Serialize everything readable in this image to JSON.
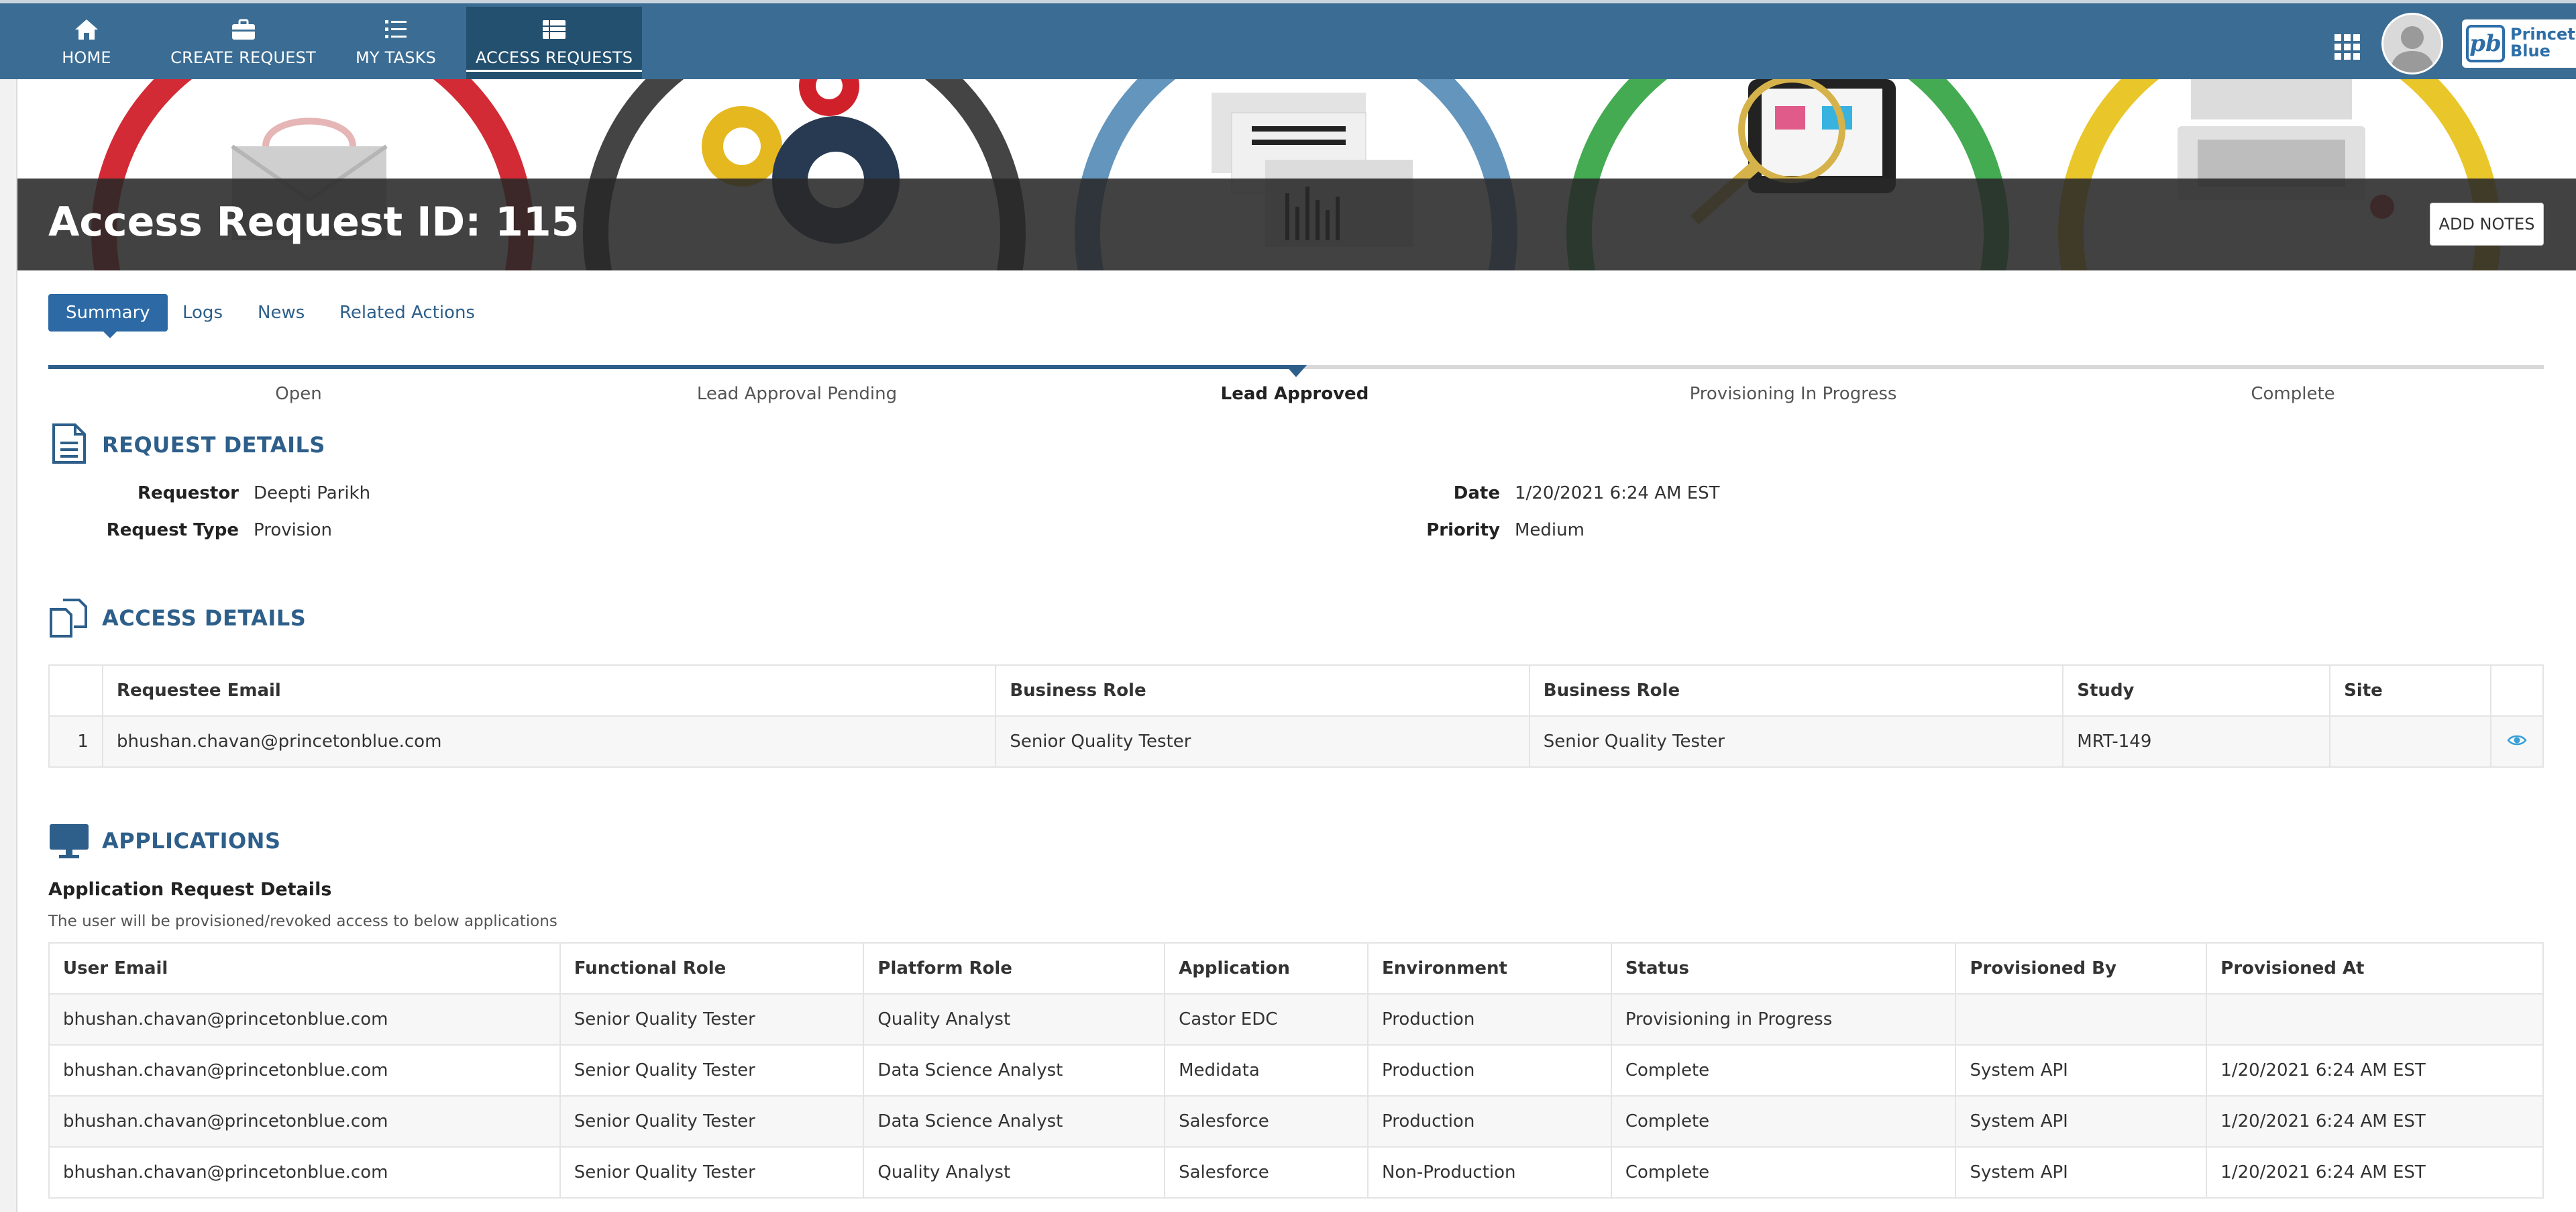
{
  "nav": {
    "items": [
      {
        "label": "HOME",
        "icon": "home-icon"
      },
      {
        "label": "CREATE REQUEST",
        "icon": "briefcase-icon"
      },
      {
        "label": "MY TASKS",
        "icon": "task-list-icon"
      },
      {
        "label": "ACCESS REQUESTS",
        "icon": "list-icon",
        "active": true
      }
    ],
    "brand_text": "Princeton Blue",
    "brand_mark": "pb"
  },
  "page": {
    "title": "Access Request ID: 115",
    "add_notes_label": "ADD NOTES"
  },
  "tabs": [
    {
      "label": "Summary",
      "active": true
    },
    {
      "label": "Logs"
    },
    {
      "label": "News"
    },
    {
      "label": "Related Actions"
    }
  ],
  "stepper": {
    "steps": [
      "Open",
      "Lead Approval Pending",
      "Lead Approved",
      "Provisioning In Progress",
      "Complete"
    ],
    "current_index": 2
  },
  "request_details": {
    "title": "REQUEST DETAILS",
    "requestor_label": "Requestor",
    "requestor": "Deepti Parikh",
    "request_type_label": "Request Type",
    "request_type": "Provision",
    "date_label": "Date",
    "date": "1/20/2021 6:24 AM EST",
    "priority_label": "Priority",
    "priority": "Medium"
  },
  "access_details": {
    "title": "ACCESS DETAILS",
    "columns": [
      "",
      "Requestee Email",
      "Business Role",
      "Business Role",
      "Study",
      "Site",
      ""
    ],
    "rows": [
      [
        "1",
        "bhushan.chavan@princetonblue.com",
        "Senior Quality Tester",
        "Senior Quality Tester",
        "MRT-149",
        ""
      ]
    ]
  },
  "applications": {
    "title": "APPLICATIONS",
    "subtitle": "Application Request Details",
    "description": "The user will be provisioned/revoked access to below applications",
    "columns": [
      "User Email",
      "Functional Role",
      "Platform Role",
      "Application",
      "Environment",
      "Status",
      "Provisioned By",
      "Provisioned At"
    ],
    "rows": [
      [
        "bhushan.chavan@princetonblue.com",
        "Senior Quality Tester",
        "Quality Analyst",
        "Castor EDC",
        "Production",
        "Provisioning in Progress",
        "",
        ""
      ],
      [
        "bhushan.chavan@princetonblue.com",
        "Senior Quality Tester",
        "Data Science Analyst",
        "Medidata",
        "Production",
        "Complete",
        "System API",
        "1/20/2021 6:24 AM EST"
      ],
      [
        "bhushan.chavan@princetonblue.com",
        "Senior Quality Tester",
        "Data Science Analyst",
        "Salesforce",
        "Production",
        "Complete",
        "System API",
        "1/20/2021 6:24 AM EST"
      ],
      [
        "bhushan.chavan@princetonblue.com",
        "Senior Quality Tester",
        "Quality Analyst",
        "Salesforce",
        "Non-Production",
        "Complete",
        "System API",
        "1/20/2021 6:24 AM EST"
      ]
    ]
  },
  "colors": {
    "nav_bg": "#3b6d94",
    "accent": "#2d5f8a",
    "banner_rings": [
      "#d0202a",
      "#3a3a3a",
      "#5b8fb9",
      "#3aa64a",
      "#e8c31e"
    ]
  }
}
